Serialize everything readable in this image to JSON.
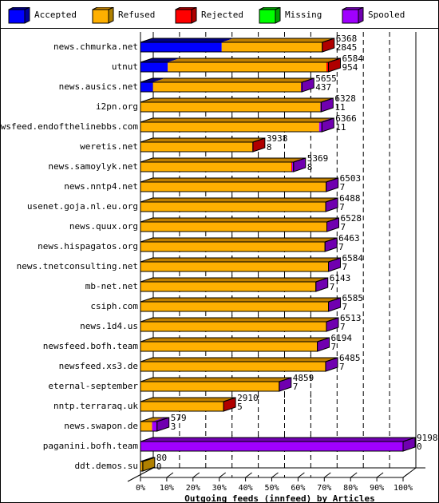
{
  "chart_data": {
    "type": "bar",
    "orientation": "horizontal",
    "stacked": true,
    "title": "",
    "xlabel": "Outgoing feeds (innfeed) by Articles",
    "ylabel": "",
    "xlim": [
      0,
      100
    ],
    "x_unit": "%",
    "xticks": [
      "0%",
      "10%",
      "20%",
      "30%",
      "40%",
      "50%",
      "60%",
      "70%",
      "80%",
      "90%",
      "100%"
    ],
    "scale_max_articles": 9198,
    "grid": true,
    "legend_position": "top",
    "legend": [
      {
        "name": "Accepted",
        "color": "#0000ff",
        "side": "#00009c",
        "top": "#000080"
      },
      {
        "name": "Refused",
        "color": "#ffb000",
        "side": "#b08000",
        "top": "#c08000"
      },
      {
        "name": "Rejected",
        "color": "#ff0000",
        "side": "#b00000",
        "top": "#a00000"
      },
      {
        "name": "Missing",
        "color": "#00ff00",
        "side": "#00a000",
        "top": "#00a000"
      },
      {
        "name": "Spooled",
        "color": "#a000ff",
        "side": "#7000b0",
        "top": "#7000b0"
      }
    ],
    "categories": [
      "news.chmurka.net",
      "utnut",
      "news.ausics.net",
      "i2pn.org",
      "newsfeed.endofthelinebbs.com",
      "weretis.net",
      "news.samoylyk.net",
      "news.nntp4.net",
      "usenet.goja.nl.eu.org",
      "news.quux.org",
      "news.hispagatos.org",
      "news.tnetconsulting.net",
      "mb-net.net",
      "csiph.com",
      "news.1d4.us",
      "newsfeed.bofh.team",
      "newsfeed.xs3.de",
      "eternal-september",
      "nntp.terraraq.uk",
      "news.swapon.de",
      "paganini.bofh.team",
      "ddt.demos.su"
    ],
    "offered": [
      6368,
      6584,
      5655,
      6328,
      6366,
      3938,
      5369,
      6503,
      6488,
      6528,
      6463,
      6584,
      6143,
      6585,
      6513,
      6194,
      6485,
      4859,
      2910,
      579,
      9198,
      80
    ],
    "accepted": [
      2845,
      954,
      437,
      11,
      11,
      8,
      8,
      7,
      7,
      7,
      7,
      7,
      7,
      7,
      7,
      7,
      7,
      7,
      5,
      3,
      0,
      0
    ],
    "series": [
      {
        "name": "Accepted",
        "values": [
          2845,
          954,
          437,
          0,
          0,
          0,
          0,
          0,
          0,
          0,
          0,
          0,
          0,
          0,
          0,
          0,
          0,
          0,
          0,
          0,
          0,
          0
        ]
      },
      {
        "name": "Refused",
        "values": [
          3513,
          5560,
          5183,
          6299,
          6258,
          3922,
          5283,
          6496,
          6481,
          6521,
          6456,
          6577,
          6136,
          6578,
          6506,
          6187,
          6478,
          4852,
          2899,
          406,
          0,
          80
        ]
      },
      {
        "name": "Rejected",
        "values": [
          10,
          70,
          0,
          0,
          0,
          16,
          30,
          0,
          0,
          0,
          0,
          0,
          0,
          0,
          0,
          0,
          0,
          0,
          11,
          0,
          0,
          0
        ]
      },
      {
        "name": "Missing",
        "values": [
          0,
          0,
          0,
          0,
          0,
          0,
          0,
          0,
          0,
          0,
          0,
          0,
          0,
          0,
          0,
          0,
          0,
          0,
          0,
          0,
          0,
          0
        ]
      },
      {
        "name": "Spooled",
        "values": [
          0,
          0,
          35,
          29,
          97,
          0,
          48,
          7,
          7,
          7,
          7,
          7,
          7,
          7,
          7,
          7,
          7,
          7,
          0,
          173,
          9198,
          0
        ]
      }
    ]
  }
}
